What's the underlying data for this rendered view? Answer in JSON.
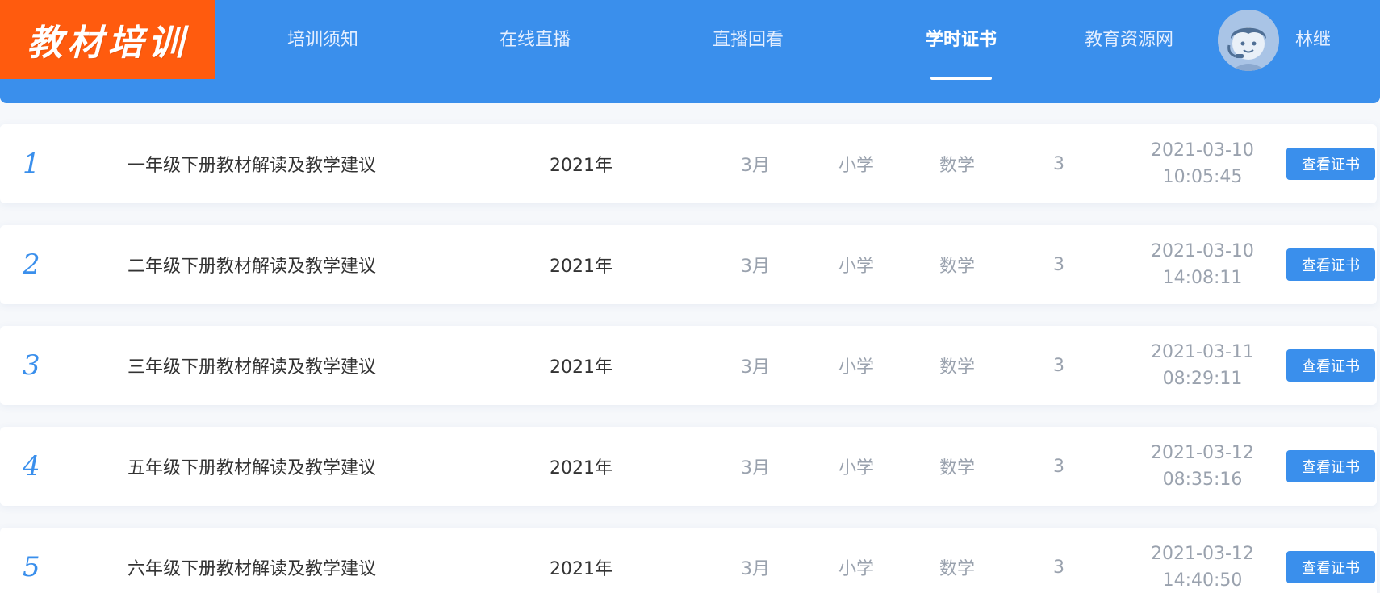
{
  "header": {
    "logo_text": "教材培训",
    "nav": [
      {
        "label": "培训须知",
        "active": false
      },
      {
        "label": "在线直播",
        "active": false
      },
      {
        "label": "直播回看",
        "active": false
      },
      {
        "label": "学时证书",
        "active": true
      },
      {
        "label": "教育资源网",
        "active": false
      }
    ],
    "user_name": "林继",
    "avatar_icon": "user-avatar-icon"
  },
  "colors": {
    "header_bg": "#3a8fec",
    "logo_bg": "#ff5b0e",
    "accent": "#3a8fec",
    "muted_text": "#9aa2ae"
  },
  "rows": [
    {
      "index": "1",
      "title": "一年级下册教材解读及教学建议",
      "year": "2021年",
      "month": "3月",
      "stage": "小学",
      "subject": "数学",
      "hours": "3",
      "date": "2021-03-10",
      "time": "10:05:45",
      "button": "查看证书"
    },
    {
      "index": "2",
      "title": "二年级下册教材解读及教学建议",
      "year": "2021年",
      "month": "3月",
      "stage": "小学",
      "subject": "数学",
      "hours": "3",
      "date": "2021-03-10",
      "time": "14:08:11",
      "button": "查看证书"
    },
    {
      "index": "3",
      "title": "三年级下册教材解读及教学建议",
      "year": "2021年",
      "month": "3月",
      "stage": "小学",
      "subject": "数学",
      "hours": "3",
      "date": "2021-03-11",
      "time": "08:29:11",
      "button": "查看证书"
    },
    {
      "index": "4",
      "title": "五年级下册教材解读及教学建议",
      "year": "2021年",
      "month": "3月",
      "stage": "小学",
      "subject": "数学",
      "hours": "3",
      "date": "2021-03-12",
      "time": "08:35:16",
      "button": "查看证书"
    },
    {
      "index": "5",
      "title": "六年级下册教材解读及教学建议",
      "year": "2021年",
      "month": "3月",
      "stage": "小学",
      "subject": "数学",
      "hours": "3",
      "date": "2021-03-12",
      "time": "14:40:50",
      "button": "查看证书"
    }
  ]
}
